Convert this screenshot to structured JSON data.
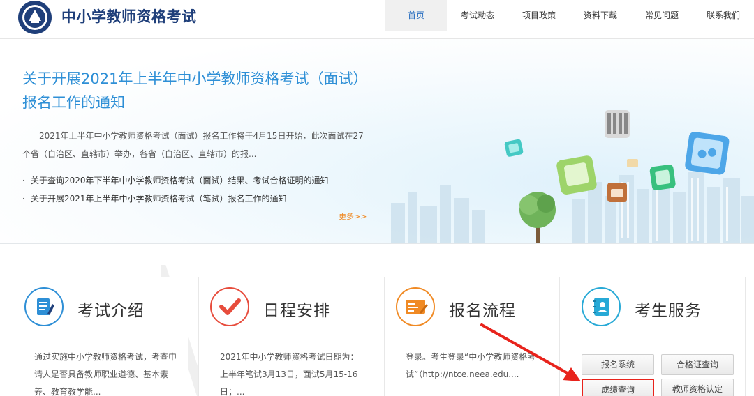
{
  "header": {
    "site_title": "中小学教师资格考试",
    "nav": [
      "首页",
      "考试动态",
      "项目政策",
      "资料下载",
      "常见问题",
      "联系我们"
    ]
  },
  "banner": {
    "headline": "关于开展2021年上半年中小学教师资格考试（面试）报名工作的通知",
    "summary": "2021年上半年中小学教师资格考试（面试）报名工作将于4月15日开始，此次面试在27个省（自治区、直辖市）举办，各省（自治区、直辖市）的报...",
    "news": [
      "关于查询2020年下半年中小学教师资格考试（面试）结果、考试合格证明的通知",
      "关于开展2021年上半年中小学教师资格考试（笔试）报名工作的通知"
    ],
    "more": "更多>>"
  },
  "cards": {
    "intro": {
      "title": "考试介绍",
      "text": "通过实施中小学教师资格考试，考查申请人是否具备教师职业道德、基本素养、教育教学能..."
    },
    "schedule": {
      "title": "日程安排",
      "text": "2021年中小学教师资格考试日期为：上半年笔试3月13日，面试5月15-16日；..."
    },
    "process": {
      "title": "报名流程",
      "text": "登录。考生登录“中小学教师资格考试”（http://ntce.neea.edu...."
    },
    "services": {
      "title": "考生服务",
      "buttons": [
        "报名系统",
        "合格证查询",
        "成绩查询",
        "教师资格认定"
      ]
    }
  },
  "colors": {
    "brand": "#1f3f7a",
    "link": "#2e8fd6",
    "more": "#f08a24",
    "highlight": "#e8231c"
  }
}
